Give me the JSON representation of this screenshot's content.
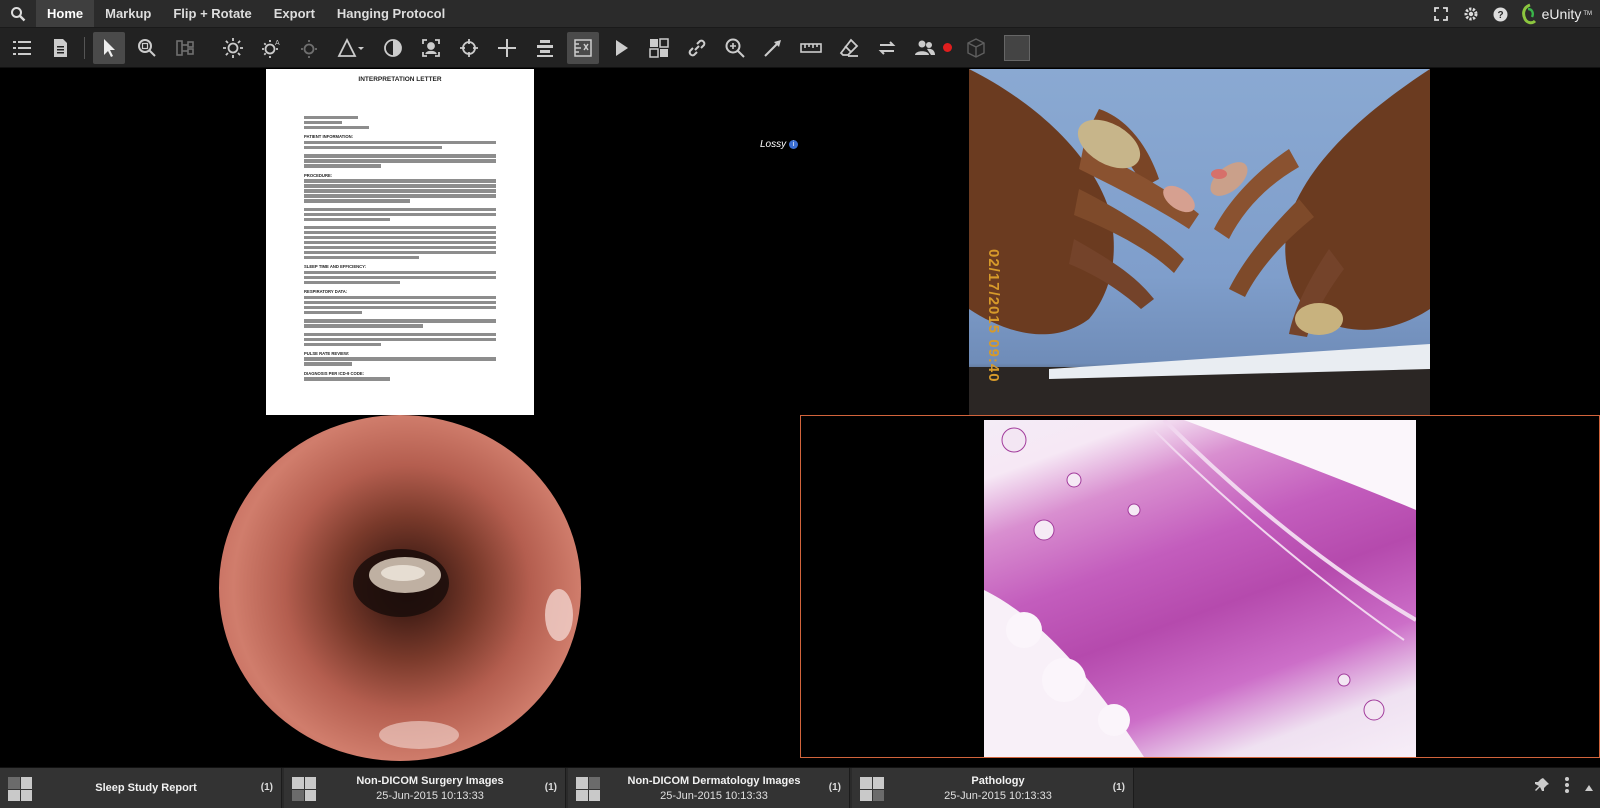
{
  "menu": {
    "tabs": [
      {
        "label": "Home",
        "active": true
      },
      {
        "label": "Markup"
      },
      {
        "label": "Flip + Rotate"
      },
      {
        "label": "Export"
      },
      {
        "label": "Hanging Protocol"
      }
    ],
    "right_icons": [
      "fullscreen-icon",
      "gear-icon",
      "help-icon"
    ],
    "brand": "eUnity",
    "brand_tm": "TM"
  },
  "toolbar": {
    "icons": [
      "series-list-icon",
      "report-icon",
      "pointer-icon",
      "zoom-fit-icon",
      "layout-icon",
      "brightness-icon",
      "auto-window-icon",
      "window-preset-icon",
      "triangle-shape-icon",
      "invert-icon",
      "portrait-icon",
      "crosshair-icon",
      "plus-cursor-icon",
      "stack-icon",
      "ruler-calibrate-icon",
      "cine-play-icon",
      "tile-icon",
      "link-icon",
      "magnify-icon",
      "arrow-icon",
      "ruler-icon",
      "eraser-icon",
      "sync-icon",
      "collaborate-icon",
      "record-dot",
      "cube-icon"
    ]
  },
  "viewer": {
    "lossy_label": "Lossy",
    "document": {
      "title": "INTERPRETATION LETTER",
      "headings": [
        "PATIENT INFORMATION:",
        "PROCEDURE:",
        "SLEEP TIME AND EFFICIENCY:",
        "RESPIRATORY DATA:",
        "PULSE RATE REVIEW:",
        "DIAGNOSIS PER ICD-9 CODE:"
      ]
    },
    "photo_timestamp": "02/17/2015 09:40"
  },
  "series_bar": {
    "items": [
      {
        "title": "Sleep Study Report",
        "date": "",
        "count": "(1)"
      },
      {
        "title": "Non-DICOM Surgery Images",
        "date": "25-Jun-2015 10:13:33",
        "count": "(1)"
      },
      {
        "title": "Non-DICOM Dermatology Images",
        "date": "25-Jun-2015 10:13:33",
        "count": "(1)"
      },
      {
        "title": "Pathology",
        "date": "25-Jun-2015 10:13:33",
        "count": "(1)"
      }
    ]
  },
  "colors": {
    "accent_border": "#d2643c",
    "record": "#e01e1e",
    "info": "#3b6fd3"
  }
}
